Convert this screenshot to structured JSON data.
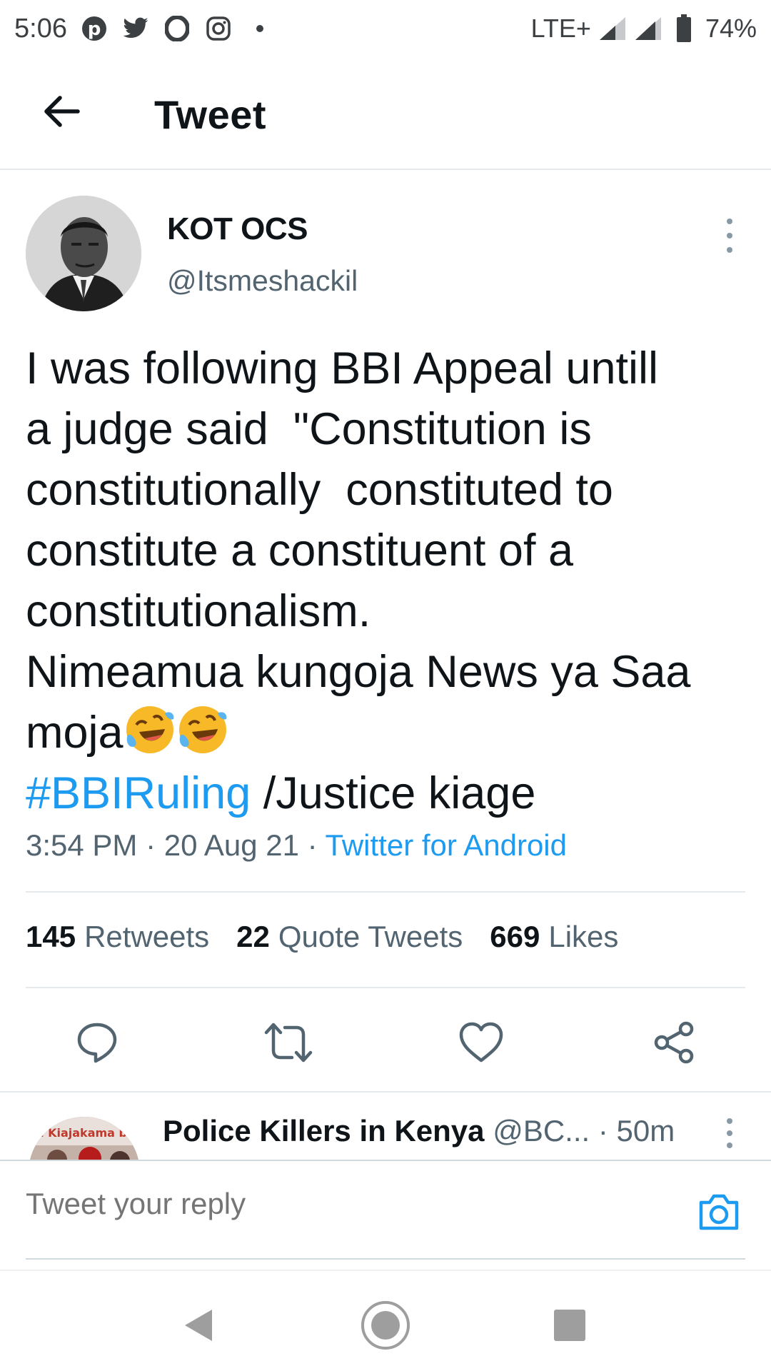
{
  "status_bar": {
    "time": "5:06",
    "network": "LTE+",
    "battery": "74%",
    "notification_icons": [
      "pinterest-icon",
      "twitter-icon",
      "opera-icon",
      "instagram-icon",
      "dot-icon"
    ]
  },
  "header": {
    "title": "Tweet"
  },
  "tweet": {
    "author_name": "KOT OCS",
    "author_handle": "@Itsmeshackil",
    "text_lines": [
      "I was following BBI Appeal untill",
      "a judge said  \"Constitution is",
      "constitutionally  constituted to",
      "constitute a constituent of a",
      "constitutionalism.",
      "Nimeamua kungoja News ya Saa",
      "moja"
    ],
    "hashtag": "#BBIRuling",
    "hashtag_suffix": " /Justice kiage",
    "time": "3:54 PM",
    "date": "20 Aug 21",
    "source": "Twitter for Android",
    "separator": " · "
  },
  "stats": {
    "retweets_count": "145",
    "retweets_label": "Retweets",
    "quotes_count": "22",
    "quotes_label": "Quote Tweets",
    "likes_count": "669",
    "likes_label": "Likes"
  },
  "reply_preview": {
    "name": "Police Killers in Kenya",
    "handle": "@BC...",
    "age": "· 50m",
    "avatar_text": "n Kiajakama br"
  },
  "compose": {
    "placeholder": "Tweet your reply"
  },
  "colors": {
    "accent": "#1d9bf0",
    "text_primary": "#0f1419",
    "text_secondary": "#536471",
    "divider": "#e6e9eb"
  }
}
